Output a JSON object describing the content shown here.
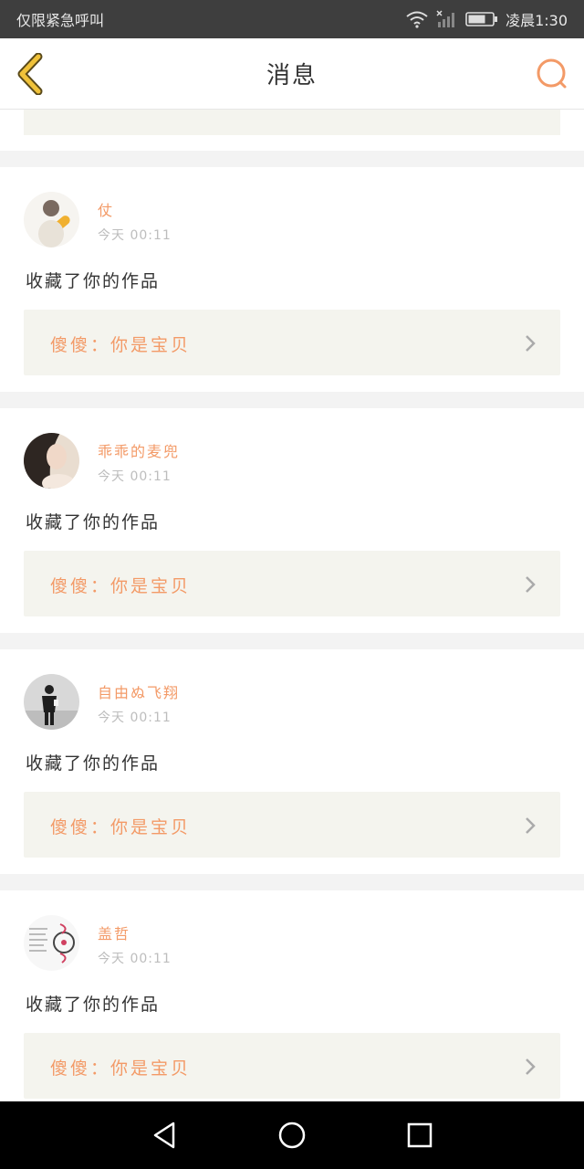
{
  "status_bar": {
    "carrier": "仅限紧急呼叫",
    "time": "凌晨1:30",
    "icons": [
      "wifi-icon",
      "signal-icon",
      "battery-icon"
    ]
  },
  "header": {
    "title": "消息",
    "back_icon": "chevron-left-icon",
    "search_icon": "search-icon"
  },
  "messages": [
    {
      "user": "仗",
      "time": "今天 00:11",
      "action": "收藏了你的作品",
      "quote": "傻傻：你是宝贝"
    },
    {
      "user": "乖乖的麦兜",
      "time": "今天 00:11",
      "action": "收藏了你的作品",
      "quote": "傻傻：你是宝贝"
    },
    {
      "user": "自由ぬ飞翔",
      "time": "今天 00:11",
      "action": "收藏了你的作品",
      "quote": "傻傻：你是宝贝"
    },
    {
      "user": "盖哲",
      "time": "今天 00:11",
      "action": "收藏了你的作品",
      "quote": "傻傻：你是宝贝"
    }
  ],
  "nav_bar": {
    "icons": [
      "back-triangle-icon",
      "home-circle-icon",
      "recents-square-icon"
    ]
  },
  "colors": {
    "accent": "#f39a67",
    "back_chevron": "#f0a22a",
    "quote_bg": "#f4f4ee"
  }
}
